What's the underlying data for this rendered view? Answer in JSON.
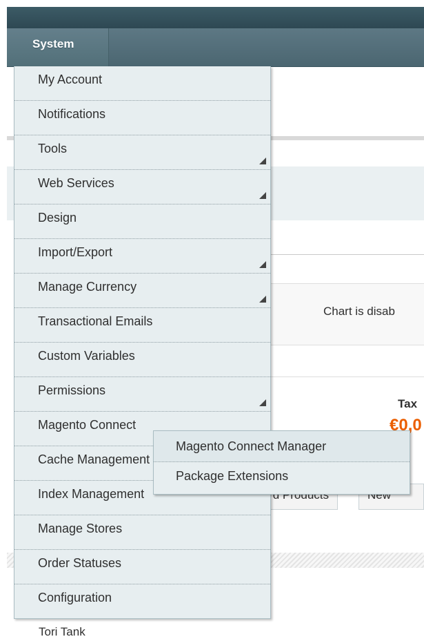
{
  "nav": {
    "system_label": "System"
  },
  "menu": {
    "items": [
      {
        "label": "My Account",
        "has_submenu": false
      },
      {
        "label": "Notifications",
        "has_submenu": false
      },
      {
        "label": "Tools",
        "has_submenu": true
      },
      {
        "label": "Web Services",
        "has_submenu": true
      },
      {
        "label": "Design",
        "has_submenu": false
      },
      {
        "label": "Import/Export",
        "has_submenu": true
      },
      {
        "label": "Manage Currency",
        "has_submenu": true
      },
      {
        "label": "Transactional Emails",
        "has_submenu": false
      },
      {
        "label": "Custom Variables",
        "has_submenu": false
      },
      {
        "label": "Permissions",
        "has_submenu": true
      },
      {
        "label": "Magento Connect",
        "has_submenu": true
      },
      {
        "label": "Cache Management",
        "has_submenu": false
      },
      {
        "label": "Index Management",
        "has_submenu": false
      },
      {
        "label": "Manage Stores",
        "has_submenu": false
      },
      {
        "label": "Order Statuses",
        "has_submenu": false
      },
      {
        "label": "Configuration",
        "has_submenu": false
      }
    ]
  },
  "submenu": {
    "items": [
      {
        "label": "Magento Connect Manager"
      },
      {
        "label": "Package Extensions"
      }
    ]
  },
  "background": {
    "chart_text": "Chart is disab",
    "tax_label": "Tax",
    "tax_value": "€0,0",
    "tabs": [
      "d Products",
      "New"
    ],
    "customer_name": "Tori Tank"
  },
  "colors": {
    "header": "#2e4853",
    "nav": "#5d7884",
    "menu_bg": "#e7eef0",
    "currency": "#eb5e00"
  }
}
